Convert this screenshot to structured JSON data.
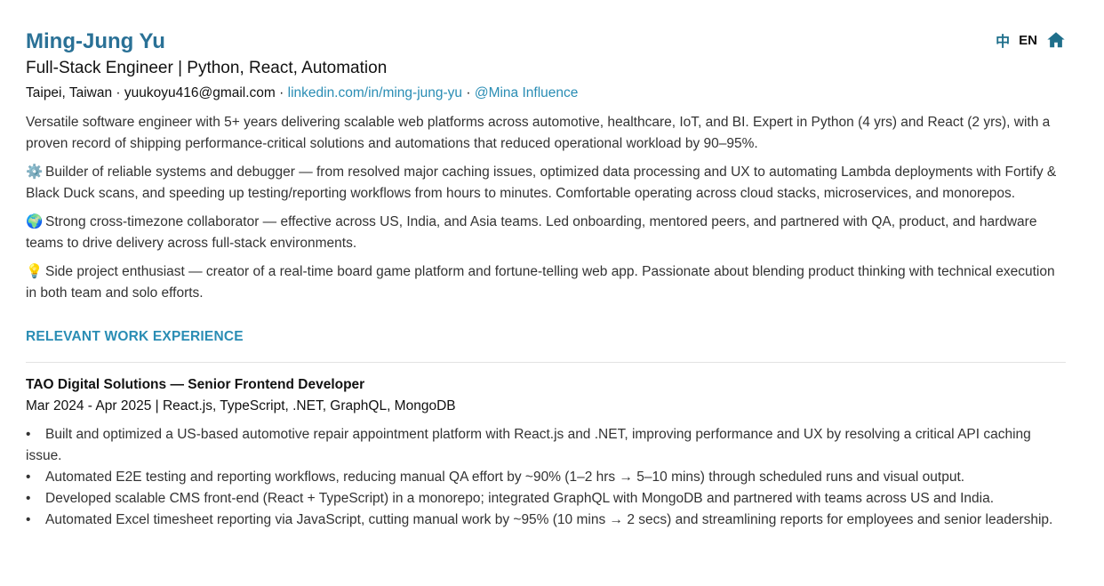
{
  "header": {
    "lang_zh": "中",
    "lang_en": "EN",
    "home_icon": "home-icon",
    "name": "Ming-Jung Yu",
    "title": "Full-Stack Engineer | Python, React, Automation",
    "location": "Taipei, Taiwan",
    "email": "yuukoyu416@gmail.com",
    "separator": " · ",
    "linkedin": "linkedin.com/in/ming-jung-yu",
    "influence": "@Mina Influence"
  },
  "summary": {
    "intro": "Versatile software engineer with 5+ years delivering scalable web platforms across automotive, healthcare, IoT, and BI. Expert in Python (4 yrs) and React (2 yrs), with a proven record of shipping performance-critical solutions and automations that reduced operational workload by 90–95%.",
    "points": [
      {
        "icon": "⚙️",
        "icon_name": "gear-icon",
        "text": "Builder of reliable systems and debugger — from resolved major caching issues, optimized data processing and UX to automating Lambda deployments with Fortify & Black Duck scans, and speeding up testing/reporting workflows from hours to minutes. Comfortable operating across cloud stacks, microservices, and monorepos."
      },
      {
        "icon": "🌍",
        "icon_name": "globe-icon",
        "text": "Strong cross-timezone collaborator — effective across US, India, and Asia teams. Led onboarding, mentored peers, and partnered with QA, product, and hardware teams to drive delivery across full-stack environments."
      },
      {
        "icon": "💡",
        "icon_name": "lightbulb-icon",
        "text": "Side project enthusiast — creator of a real-time board game platform and fortune-telling web app. Passionate about blending product thinking with technical execution in both team and solo efforts."
      }
    ]
  },
  "experience": {
    "heading": "RELEVANT WORK EXPERIENCE",
    "jobs": [
      {
        "title": "TAO Digital Solutions — Senior Frontend Developer",
        "meta": "Mar 2024 - Apr 2025 | React.js, TypeScript, .NET, GraphQL, MongoDB",
        "bullet_char": "•",
        "bullets": [
          "Built and optimized a US-based automotive repair appointment platform with React.js and .NET, improving performance and UX by resolving a critical API caching issue.",
          "Automated E2E testing and reporting workflows, reducing manual QA effort by ~90% (1–2 hrs → 5–10 mins) through scheduled runs and visual output.",
          "Developed scalable CMS front-end (React + TypeScript) in a monorepo; integrated GraphQL with MongoDB and partnered with teams across US and India.",
          "Automated Excel timesheet reporting via JavaScript, cutting manual work by ~95% (10 mins → 2 secs) and streamlining reports for employees and senior leadership."
        ]
      }
    ]
  },
  "colors": {
    "accent": "#2a7196",
    "link": "#2a8db4",
    "text": "#333333"
  }
}
